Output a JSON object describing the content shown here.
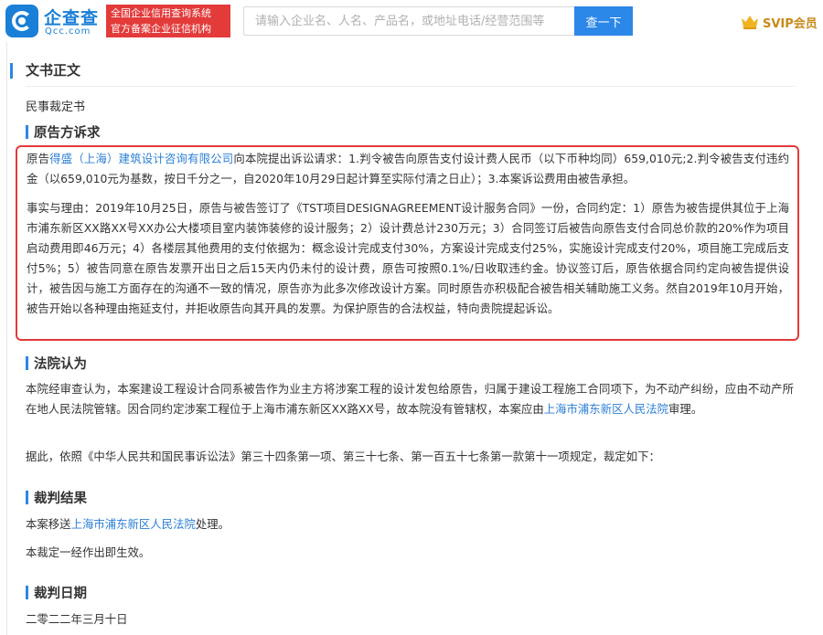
{
  "header": {
    "logo_cn": "企查查",
    "logo_en": "Qcc.com",
    "slogan_line1": "全国企业信用查询系统",
    "slogan_line2": "官方备案企业征信机构",
    "search_placeholder": "请输入企业名、人名、产品名，或地址电话/经营范围等",
    "search_button": "查一下",
    "vip_label": "SVIP会员",
    "brand_color": "#1a7fd6",
    "accent_red": "#e33a3a"
  },
  "document": {
    "title": "文书正文",
    "type": "民事裁定书",
    "sections": {
      "claims": {
        "title": "原告方诉求",
        "p1_before_link": "原告",
        "p1_link": "得盛（上海）建筑设计咨询有限公司",
        "p1_after_link": "向本院提出诉讼请求：1.判令被告向原告支付设计费人民币（以下币种均同）659,010元;2.判令被告支付违约金（以659,010元为基数，按日千分之一，自2020年10月29日起计算至实际付清之日止）；3.本案诉讼费用由被告承担。",
        "p2": "事实与理由：2019年10月25日，原告与被告签订了《TST项目DESIGNAGREEMENT设计服务合同》一份，合同约定：1）原告为被告提供其位于上海市浦东新区XX路XX号XX办公大楼项目室内装饰装修的设计服务；2）设计费总计230万元；3）合同签订后被告向原告支付合同总价款的20%作为项目启动费用即46万元；4）各楼层其他费用的支付依据为：概念设计完成支付30%，方案设计完成支付25%，实施设计完成支付20%，项目施工完成后支付5%；5）被告同意在原告发票开出日之后15天内仍未付的设计费，原告可按照0.1%/日收取违约金。协议签订后，原告依据合同约定向被告提供设计，被告因与施工方面存在的沟通不一致的情况，原告亦为此多次修改设计方案。同时原告亦积极配合被告相关辅助施工义务。然自2019年10月开始，被告开始以各种理由拖延支付，并拒收原告向其开具的发票。为保护原告的合法权益，特向贵院提起诉讼。"
      },
      "court_opinion": {
        "title": "法院认为",
        "p1_before_link": "本院经审查认为，本案建设工程设计合同系被告作为业主方将涉案工程的设计发包给原告，归属于建设工程施工合同项下，为不动产纠纷，应由不动产所在地人民法院管辖。因合同约定涉案工程位于上海市浦东新区XX路XX号，故本院没有管辖权，本案应由",
        "p1_link": "上海市浦东新区人民法院",
        "p1_after_link": "审理。",
        "p2": "据此，依照《中华人民共和国民事诉讼法》第三十四条第一项、第三十七条、第一百五十七条第一款第十一项规定，裁定如下："
      },
      "result": {
        "title": "裁判结果",
        "p1_before_link": "本案移送",
        "p1_link": "上海市浦东新区人民法院",
        "p1_after_link": "处理。",
        "p2": "本裁定一经作出即生效。"
      },
      "date": {
        "title": "裁判日期",
        "value": "二零二二年三月十日"
      }
    }
  }
}
